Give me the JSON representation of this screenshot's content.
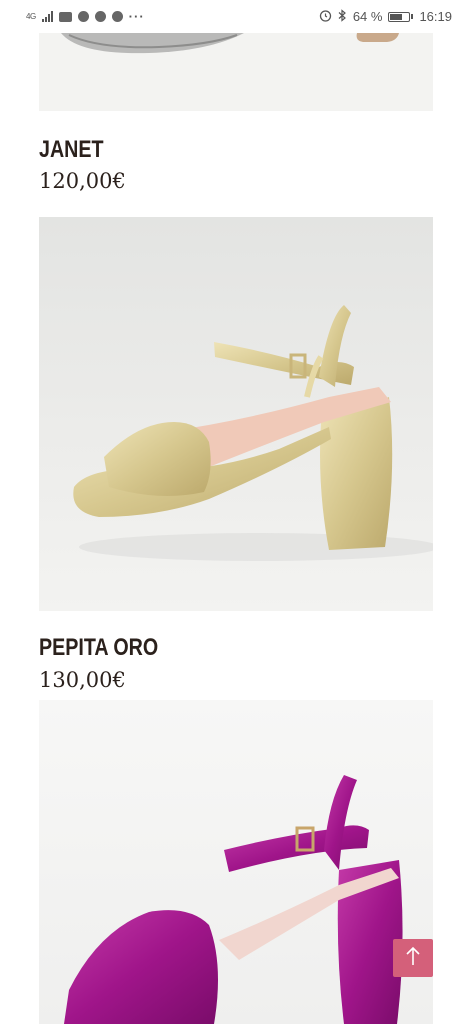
{
  "status_bar": {
    "network": "4G",
    "battery": "64 %",
    "battery_level": 0.64,
    "time": "16:19",
    "more": "···"
  },
  "products": [
    {
      "name": "JANET",
      "price": "120,00€",
      "color": "silver"
    },
    {
      "name": "PEPITA ORO",
      "price": "130,00€",
      "color": "gold"
    },
    {
      "name": "",
      "price": "",
      "color": "fuchsia"
    }
  ],
  "colors": {
    "text": "#2b211c",
    "scroll_button": "#d4607a",
    "gold_shoe": "#d8c98f",
    "fuchsia_shoe": "#a0158a"
  },
  "icons": {
    "scroll_top": "arrow-up-icon",
    "alarm": "alarm-icon",
    "bluetooth": "bluetooth-icon"
  }
}
